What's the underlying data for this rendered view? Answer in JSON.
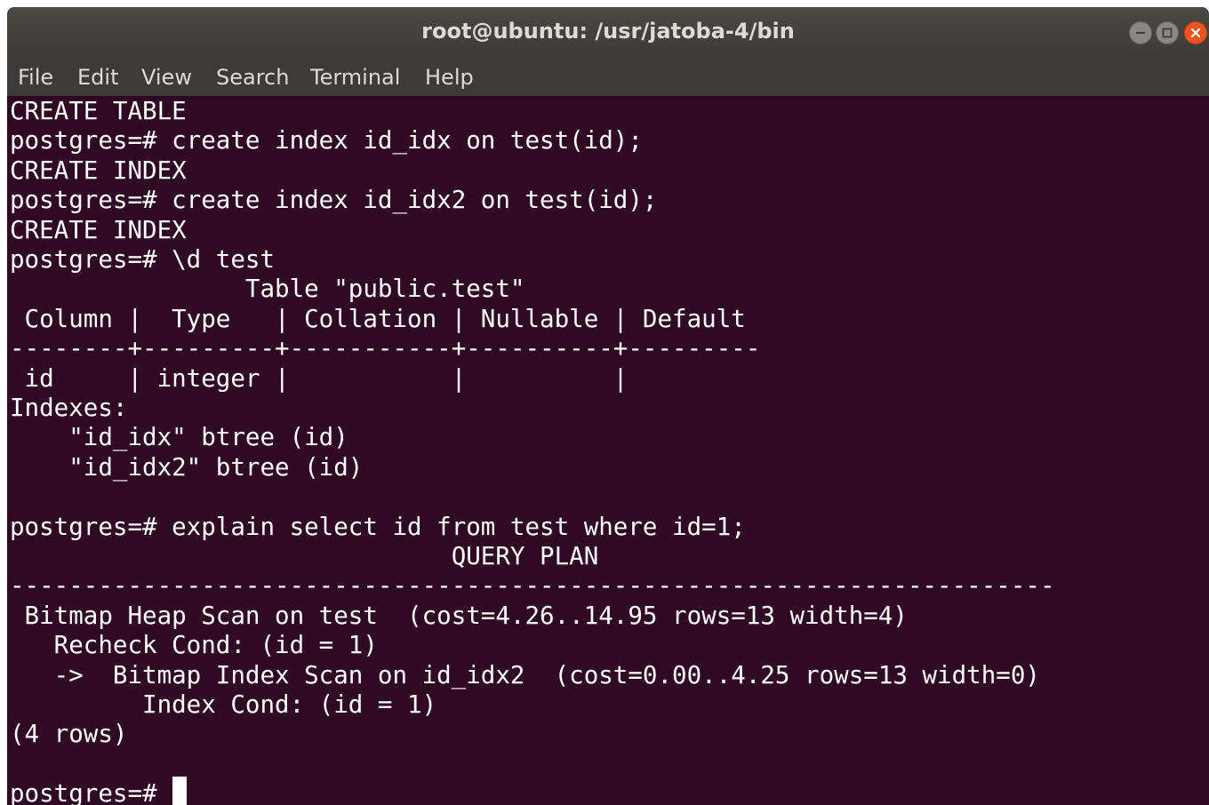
{
  "window": {
    "title": "root@ubuntu: /usr/jatoba-4/bin"
  },
  "menubar": {
    "items": [
      "File",
      "Edit",
      "View",
      "Search",
      "Terminal",
      "Help"
    ]
  },
  "terminal": {
    "lines": [
      "CREATE TABLE",
      "postgres=# create index id_idx on test(id);",
      "CREATE INDEX",
      "postgres=# create index id_idx2 on test(id);",
      "CREATE INDEX",
      "postgres=# \\d test",
      "                Table \"public.test\"",
      " Column |  Type   | Collation | Nullable | Default",
      "--------+---------+-----------+----------+---------",
      " id     | integer |           |          |",
      "Indexes:",
      "    \"id_idx\" btree (id)",
      "    \"id_idx2\" btree (id)",
      "",
      "postgres=# explain select id from test where id=1;",
      "                              QUERY PLAN",
      "-----------------------------------------------------------------------",
      " Bitmap Heap Scan on test  (cost=4.26..14.95 rows=13 width=4)",
      "   Recheck Cond: (id = 1)",
      "   ->  Bitmap Index Scan on id_idx2  (cost=0.00..4.25 rows=13 width=0)",
      "         Index Cond: (id = 1)",
      "(4 rows)",
      "",
      "postgres=# "
    ]
  }
}
